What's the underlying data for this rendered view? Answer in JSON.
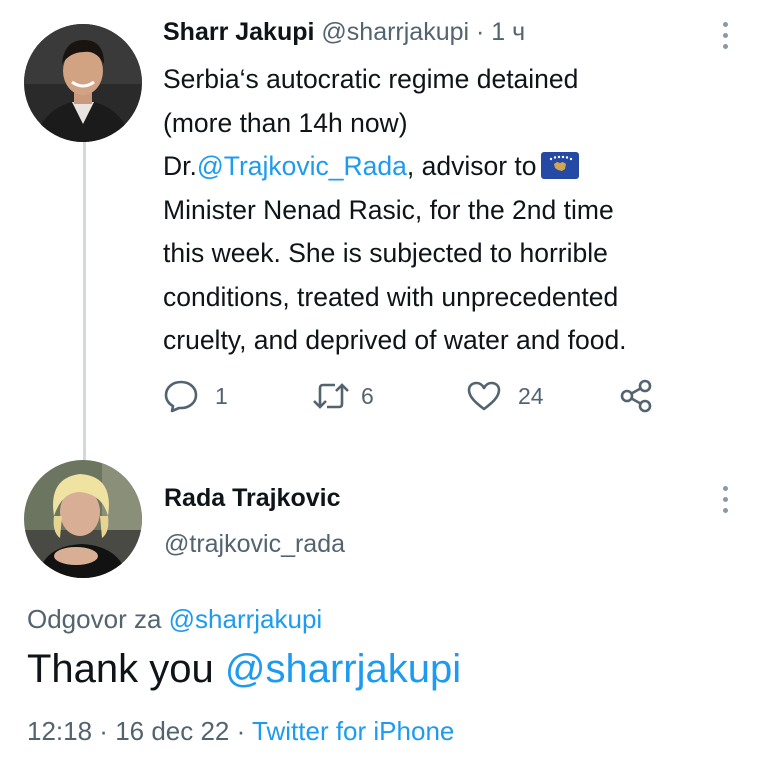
{
  "tweet1": {
    "author_name": "Sharr Jakupi",
    "author_handle": "@sharrjakupi",
    "separator": " · ",
    "time": "1 ч",
    "line1": "Serbia‘s autocratic regime detained",
    "line2": "(more than 14h now)",
    "line3_prefix": "Dr.",
    "line3_mention": "@Trajkovic_Rada",
    "line3_suffix": ", advisor to",
    "line4": "Minister Nenad Rasic, for the 2nd time",
    "line5": "this week. She is subjected to horrible",
    "line6": "conditions, treated with unprecedented",
    "line7": "cruelty, and deprived of water and food.",
    "flag_icon": "kosovo-flag-icon",
    "replies": "1",
    "retweets": "6",
    "likes": "24"
  },
  "tweet2": {
    "author_name": "Rada Trajkovic",
    "author_handle": "@trajkovic_rada",
    "reply_prefix": "Odgovor za ",
    "reply_handle": "@sharrjakupi",
    "text_prefix": "Thank you ",
    "text_mention": "@sharrjakupi",
    "time": "12:18",
    "separator": " · ",
    "date": "16 dec 22",
    "separator2": " · ",
    "source": "Twitter for iPhone"
  },
  "colors": {
    "accent": "#1d9bf0",
    "secondary_text": "#536471",
    "primary_text": "#0f1419",
    "thread_line": "#cfd9de",
    "flag_blue": "#244aa5",
    "flag_gold": "#d0a650"
  }
}
